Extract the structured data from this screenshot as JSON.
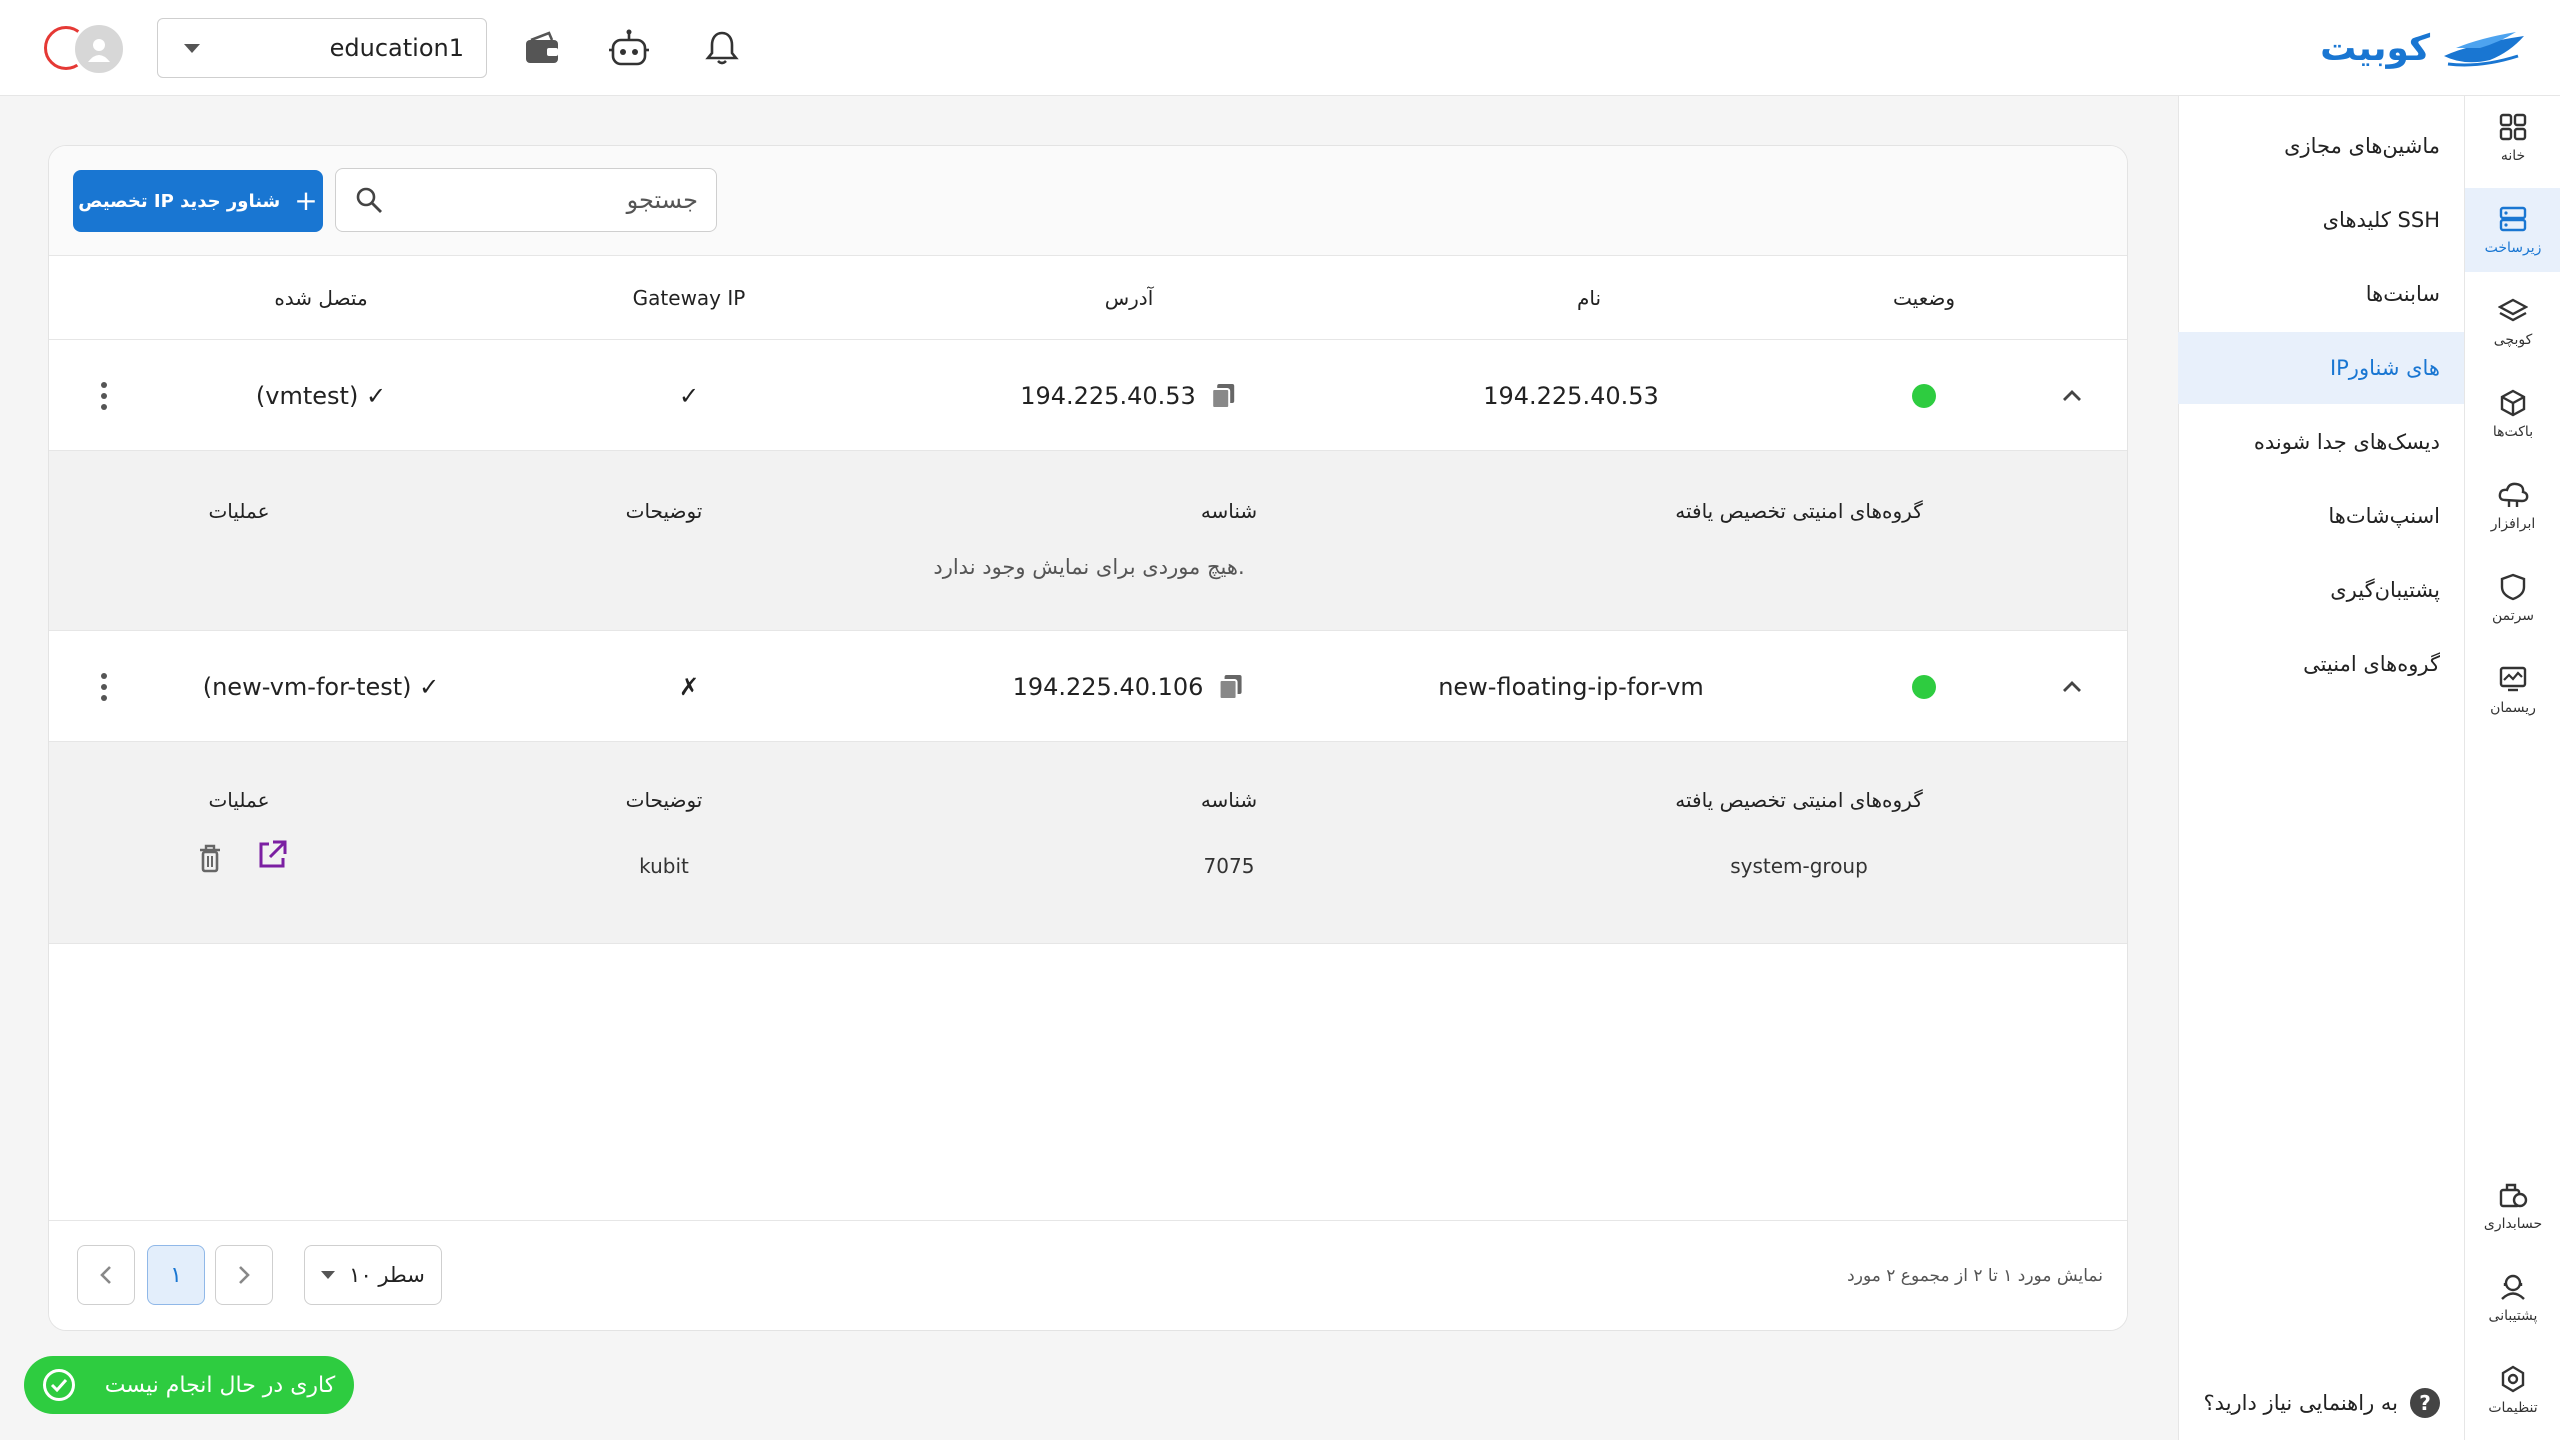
{
  "header": {
    "logo_text": "کوبیت",
    "project_value": "education1",
    "icons": [
      "wallet-icon",
      "robot-icon",
      "bell-icon"
    ]
  },
  "rail": {
    "items": [
      {
        "label": "خانه",
        "icon": "grid-icon"
      },
      {
        "label": "زیرساخت",
        "icon": "server-icon",
        "active": true
      },
      {
        "label": "کوبچی",
        "icon": "layers-icon"
      },
      {
        "label": "باکت‌ها",
        "icon": "cube-icon"
      },
      {
        "label": "ابرافزار",
        "icon": "cloud-icon"
      },
      {
        "label": "سرتمن",
        "icon": "shield-icon"
      },
      {
        "label": "ریسمان",
        "icon": "monitor-icon"
      },
      {
        "label": "حسابداری",
        "icon": "accounting-icon"
      },
      {
        "label": "پشتیبانی",
        "icon": "support-icon"
      },
      {
        "label": "تنظیمات",
        "icon": "settings-icon"
      }
    ]
  },
  "submenu": {
    "items": [
      {
        "label": "ماشین‌های مجازی"
      },
      {
        "label": "کلیدهای SSH"
      },
      {
        "label": "سابنت‌ها"
      },
      {
        "label": "IPهای شناور",
        "active": true
      },
      {
        "label": "دیسک‌های جدا شونده"
      },
      {
        "label": "اسنپ‌شات‌ها"
      },
      {
        "label": "پشتیبان‌گیری"
      },
      {
        "label": "گروه‌های امنیتی"
      }
    ],
    "help_text": "به راهنمایی نیاز دارید؟",
    "help_symbol": "?"
  },
  "toolbar": {
    "new_button_label": "تخصیص IP شناور جدید",
    "plus_symbol": "+",
    "search_placeholder": "جستجو"
  },
  "table": {
    "headers": {
      "status": "وضعیت",
      "name": "نام",
      "address": "آدرس",
      "gateway": "Gateway IP",
      "connected": "متصل شده"
    },
    "detail_headers": {
      "groups": "گروه‌های امنیتی تخصیص یافته",
      "id": "شناسه",
      "description": "توضیحات",
      "actions": "عملیات"
    },
    "rows": [
      {
        "status_color": "#2ecc40",
        "name": "194.225.40.53",
        "address": "194.225.40.53",
        "gateway": "✓",
        "connected": "(vmtest) ✓",
        "empty_text": "هیچ موردی برای نمایش وجود ندارد."
      },
      {
        "status_color": "#2ecc40",
        "name": "new-floating-ip-for-vm",
        "address": "194.225.40.106",
        "gateway": "✗",
        "connected": "(new-vm-for-test) ✓",
        "detail": {
          "group": "system-group",
          "id": "7075",
          "description": "kubit"
        }
      }
    ]
  },
  "footer": {
    "range_text": "نمایش مورد ۱ تا ۲ از مجموع ۲ مورد",
    "rows_per_page": "۱۰ سطر",
    "current_page": "۱"
  },
  "toast": {
    "text": "کاری در حال انجام نیست"
  }
}
